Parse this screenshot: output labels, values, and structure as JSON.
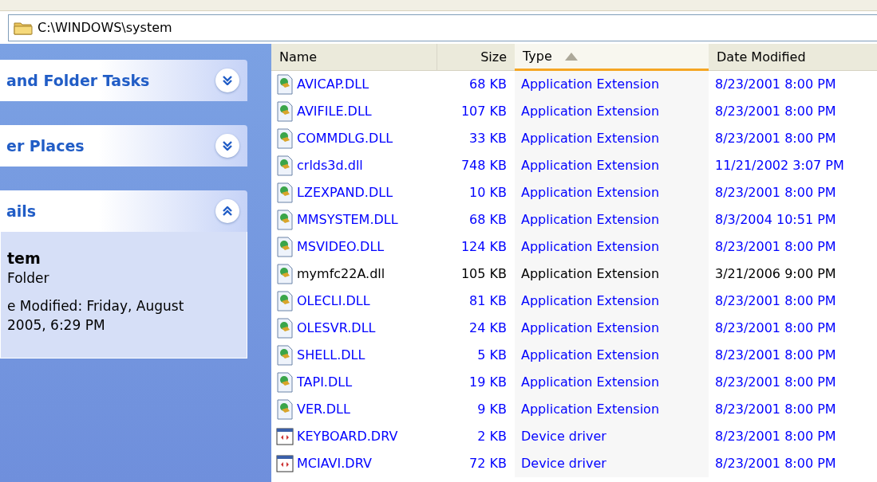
{
  "address_bar": {
    "path": "C:\\WINDOWS\\system"
  },
  "task_panels": [
    {
      "title": "and Folder Tasks",
      "expanded": false
    },
    {
      "title": "er Places",
      "expanded": false
    },
    {
      "title": "ails",
      "expanded": true,
      "item_name": "tem",
      "item_type": "Folder",
      "details": [
        "e Modified: Friday, August",
        "2005, 6:29 PM"
      ]
    }
  ],
  "table": {
    "columns": [
      {
        "label": "Name",
        "kind": "text",
        "sorted": false
      },
      {
        "label": "Size",
        "kind": "number",
        "sorted": false
      },
      {
        "label": "Type",
        "kind": "text",
        "sorted": true
      },
      {
        "label": "Date Modified",
        "kind": "text",
        "sorted": false
      }
    ],
    "rows": [
      {
        "kind": "dll",
        "compressed": true,
        "cells": [
          "AVICAP.DLL",
          "68 KB",
          "Application Extension",
          "8/23/2001 8:00 PM"
        ]
      },
      {
        "kind": "dll",
        "compressed": true,
        "cells": [
          "AVIFILE.DLL",
          "107 KB",
          "Application Extension",
          "8/23/2001 8:00 PM"
        ]
      },
      {
        "kind": "dll",
        "compressed": true,
        "cells": [
          "COMMDLG.DLL",
          "33 KB",
          "Application Extension",
          "8/23/2001 8:00 PM"
        ]
      },
      {
        "kind": "dll",
        "compressed": true,
        "cells": [
          "crlds3d.dll",
          "748 KB",
          "Application Extension",
          "11/21/2002 3:07 PM"
        ]
      },
      {
        "kind": "dll",
        "compressed": true,
        "cells": [
          "LZEXPAND.DLL",
          "10 KB",
          "Application Extension",
          "8/23/2001 8:00 PM"
        ]
      },
      {
        "kind": "dll",
        "compressed": true,
        "cells": [
          "MMSYSTEM.DLL",
          "68 KB",
          "Application Extension",
          "8/3/2004 10:51 PM"
        ]
      },
      {
        "kind": "dll",
        "compressed": true,
        "cells": [
          "MSVIDEO.DLL",
          "124 KB",
          "Application Extension",
          "8/23/2001 8:00 PM"
        ]
      },
      {
        "kind": "dll",
        "compressed": false,
        "cells": [
          "mymfc22A.dll",
          "105 KB",
          "Application Extension",
          "3/21/2006 9:00 PM"
        ]
      },
      {
        "kind": "dll",
        "compressed": true,
        "cells": [
          "OLECLI.DLL",
          "81 KB",
          "Application Extension",
          "8/23/2001 8:00 PM"
        ]
      },
      {
        "kind": "dll",
        "compressed": true,
        "cells": [
          "OLESVR.DLL",
          "24 KB",
          "Application Extension",
          "8/23/2001 8:00 PM"
        ]
      },
      {
        "kind": "dll",
        "compressed": true,
        "cells": [
          "SHELL.DLL",
          "5 KB",
          "Application Extension",
          "8/23/2001 8:00 PM"
        ]
      },
      {
        "kind": "dll",
        "compressed": true,
        "cells": [
          "TAPI.DLL",
          "19 KB",
          "Application Extension",
          "8/23/2001 8:00 PM"
        ]
      },
      {
        "kind": "dll",
        "compressed": true,
        "cells": [
          "VER.DLL",
          "9 KB",
          "Application Extension",
          "8/23/2001 8:00 PM"
        ]
      },
      {
        "kind": "drv",
        "compressed": true,
        "cells": [
          "KEYBOARD.DRV",
          "2 KB",
          "Device driver",
          "8/23/2001 8:00 PM"
        ]
      },
      {
        "kind": "drv",
        "compressed": true,
        "cells": [
          "MCIAVI.DRV",
          "72 KB",
          "Device driver",
          "8/23/2001 8:00 PM"
        ]
      }
    ]
  }
}
